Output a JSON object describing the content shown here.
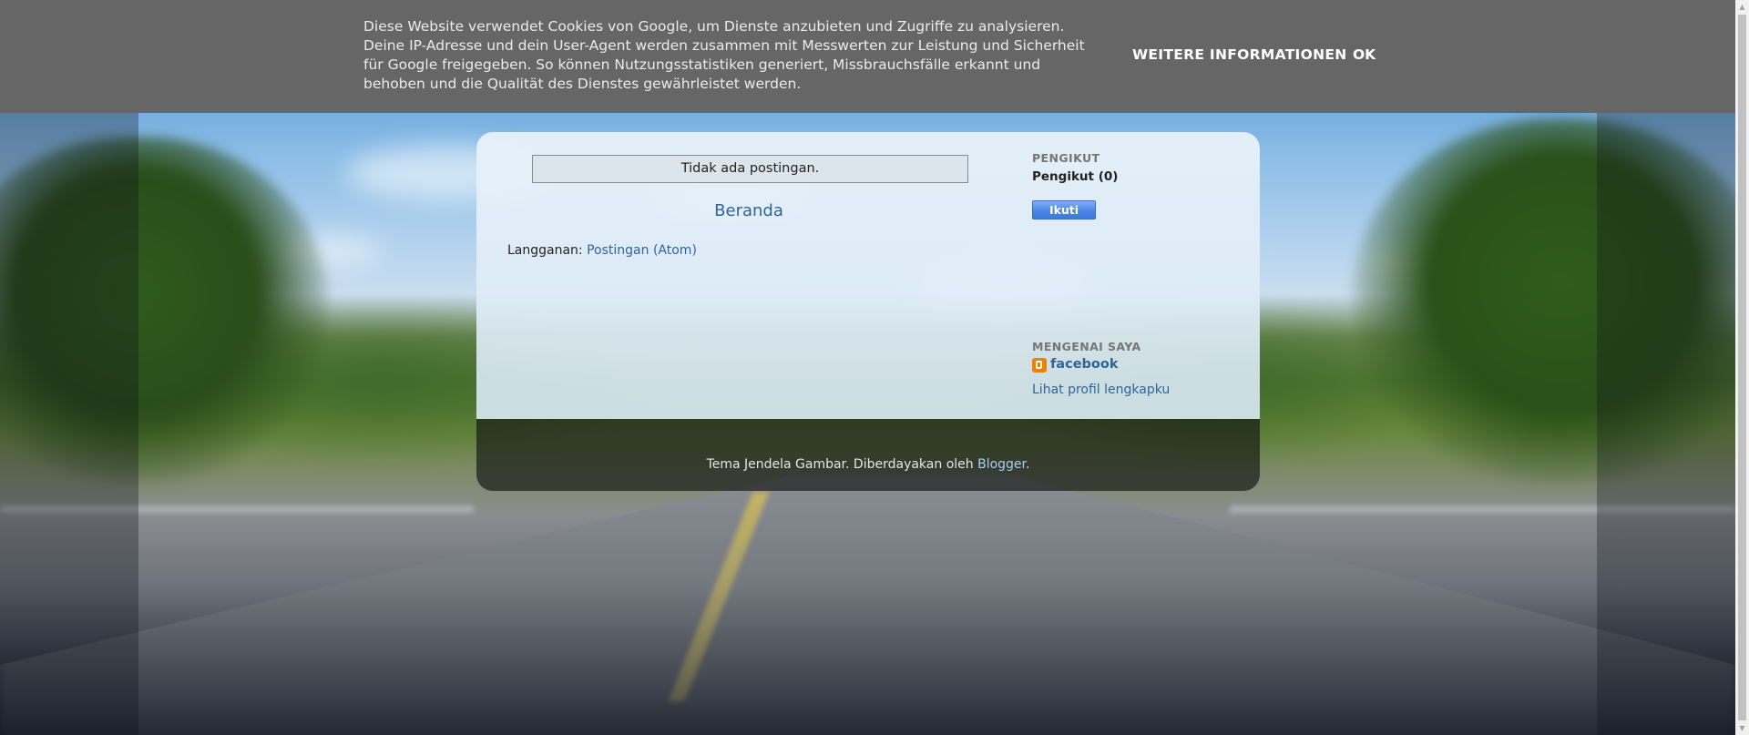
{
  "cookie_bar": {
    "text": "Diese Website verwendet Cookies von Google, um Dienste anzubieten und Zugriffe zu analysieren. Deine IP-Adresse und dein User-Agent werden zusammen mit Messwerten zur Leistung und Sicherheit für Google freigegeben. So können Nutzungsstatistiken generiert, Missbrauchsfälle erkannt und behoben und die Qualität des Dienstes gewährleistet werden.",
    "more_info_label": "WEITERE INFORMATIONEN",
    "ok_label": "OK"
  },
  "main": {
    "no_posts": "Tidak ada postingan.",
    "home_link": "Beranda",
    "subscribe_label": "Langganan:",
    "subscribe_link": "Postingan (Atom)"
  },
  "sidebar": {
    "followers_title": "PENGIKUT",
    "followers_count": "Pengikut (0)",
    "follow_button": "Ikuti",
    "about_title": "MENGENAI SAYA",
    "profile_name": "facebook",
    "profile_link": "Lihat profil lengkapku"
  },
  "footer": {
    "theme_text": "Tema Jendela Gambar. Diberdayakan oleh ",
    "powered_link": "Blogger",
    "period": "."
  },
  "icons": {
    "blogger": "blogger-icon",
    "scroll_up": "scroll-up-arrow-icon",
    "scroll_down": "scroll-down-arrow-icon"
  },
  "colors": {
    "link": "#2f6499",
    "cookie_bar_bg": "#666666",
    "follow_button": "#4a86e8",
    "blogger_orange": "#f57d00"
  }
}
